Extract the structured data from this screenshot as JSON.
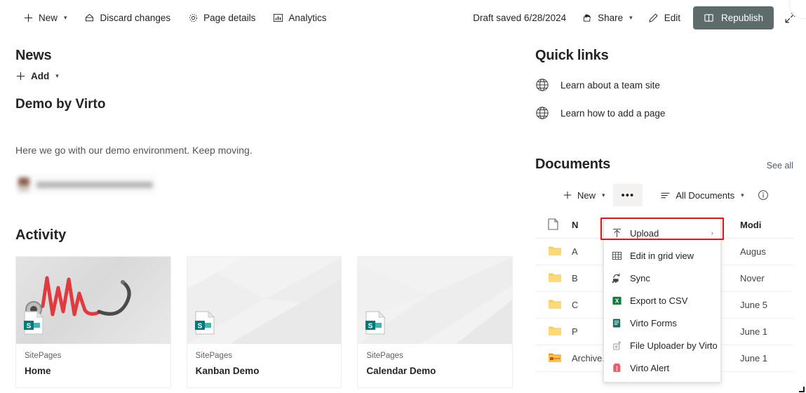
{
  "commandbar": {
    "new_label": "New",
    "discard_label": "Discard changes",
    "page_details_label": "Page details",
    "analytics_label": "Analytics",
    "draft_status": "Draft saved 6/28/2024",
    "share_label": "Share",
    "edit_label": "Edit",
    "republish_label": "Republish",
    "republish_bg": "#5e6b6b"
  },
  "news": {
    "section_title": "News",
    "add_label": "Add",
    "post_title": "Demo by Virto",
    "post_desc": "Here we go with our demo environment. Keep moving."
  },
  "activity": {
    "section_title": "Activity",
    "cards": [
      {
        "library": "SitePages",
        "name": "Home"
      },
      {
        "library": "SitePages",
        "name": "Kanban Demo"
      },
      {
        "library": "SitePages",
        "name": "Calendar Demo"
      }
    ]
  },
  "quick_links": {
    "section_title": "Quick links",
    "items": [
      {
        "label": "Learn about a team site"
      },
      {
        "label": "Learn how to add a page"
      }
    ]
  },
  "documents": {
    "section_title": "Documents",
    "see_all_label": "See all",
    "toolbar": {
      "new_label": "New",
      "more_label": "•••",
      "view_label": "All Documents"
    },
    "columns": {
      "name": "N",
      "modified": "Modi"
    },
    "rows": [
      {
        "name": "A",
        "modified": "Augus",
        "icon": "folder-icon"
      },
      {
        "name": "B",
        "modified": "Nover",
        "icon": "folder-icon"
      },
      {
        "name": "C",
        "modified": "June 5",
        "icon": "folder-icon"
      },
      {
        "name": "P",
        "modified": "June 1",
        "icon": "folder-icon"
      },
      {
        "name": "Archive.zip",
        "modified": "June 1",
        "icon": "zip-icon"
      }
    ]
  },
  "context_menu": {
    "items": [
      {
        "label": "Upload",
        "icon": "upload-icon",
        "submenu": "›",
        "highlighted": true
      },
      {
        "label": "Edit in grid view",
        "icon": "grid-icon",
        "submenu": "",
        "highlighted": false
      },
      {
        "label": "Sync",
        "icon": "sync-icon",
        "submenu": "",
        "highlighted": false
      },
      {
        "label": "Export to CSV",
        "icon": "excel-icon",
        "submenu": "",
        "highlighted": false
      },
      {
        "label": "Virto Forms",
        "icon": "virto-forms-icon",
        "submenu": "",
        "highlighted": false
      },
      {
        "label": "File Uploader by Virto",
        "icon": "file-uploader-icon",
        "submenu": "",
        "highlighted": false
      },
      {
        "label": "Virto Alert",
        "icon": "virto-alert-icon",
        "submenu": "",
        "highlighted": false
      }
    ],
    "highlight_color": "#f30f0f"
  }
}
